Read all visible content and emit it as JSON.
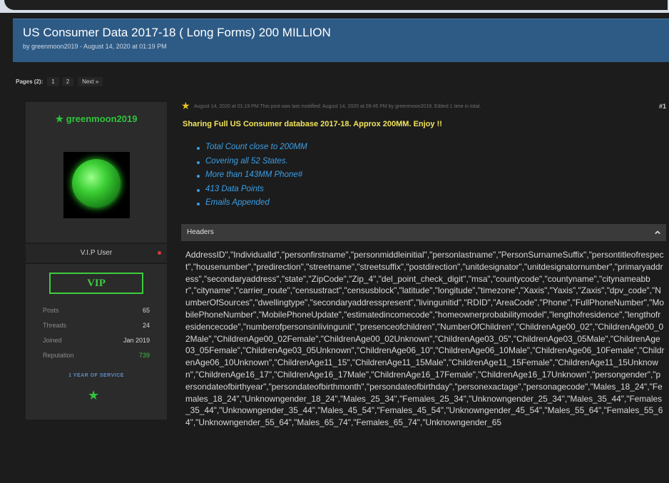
{
  "thread": {
    "title": "US Consumer Data 2017-18 ( Long Forms) 200 MILLION",
    "byline": "by greenmoon2019 - August 14, 2020 at 01:19 PM"
  },
  "pagination": {
    "label": "Pages (2):",
    "pages": [
      "1",
      "2"
    ],
    "next_label": "Next »"
  },
  "user": {
    "username": "★ greenmoon2019",
    "role": "V.I.P User",
    "badge": "VIP",
    "stats": [
      {
        "key": "Posts",
        "value": "65"
      },
      {
        "key": "Threads",
        "value": "24"
      },
      {
        "key": "Joined",
        "value": "Jan 2019"
      },
      {
        "key": "Reputation",
        "value": "739"
      }
    ],
    "service": "1 YEAR OF SERVICE"
  },
  "post": {
    "meta": "August 14, 2020 at 01:19 PM   This post was last modified: August 14, 2020 at 09:45 PM by greenmoon2019. Edited 1 time in total.",
    "number": "#1",
    "headline": "Sharing Full US Consumer database 2017-18. Approx 200MM. Enjoy !!",
    "bullets": [
      "Total Count close to 200MM",
      "Covering all 52 States.",
      "More than 143MM Phone#",
      "413 Data Points",
      "Emails Appended"
    ],
    "headers_label": "Headers",
    "headers_text": "AddressID\",\"IndividualId\",\"personfirstname\",\"personmiddleinitial\",\"personlastname\",\"PersonSurnameSuffix\",\"persontitleofrespect\",\"housenumber\",\"predirection\",\"streetname\",\"streetsuffix\",\"postdirection\",\"unitdesignator\",\"unitdesignatornumber\",\"primaryaddress\",\"secondaryaddress\",\"state\",\"ZipCode\",\"Zip_4\",\"del_point_check_digit\",\"msa\",\"countycode\",\"countyname\",\"citynameabbr\",\"cityname\",\"carrier_route\",\"censustract\",\"censusblock\",\"latitude\",\"longitude\",\"timezone\",\"Xaxis\",\"Yaxis\",\"Zaxis\",\"dpv_code\",\"NumberOfSources\",\"dwellingtype\",\"secondaryaddresspresent\",\"livingunitid\",\"RDID\",\"AreaCode\",\"Phone\",\"FullPhoneNumber\",\"MobilePhoneNumber\",\"MobilePhoneUpdate\",\"estimatedincomecode\",\"homeownerprobabilitymodel\",\"lengthofresidence\",\"lengthofresidencecode\",\"numberofpersonsinlivingunit\",\"presenceofchildren\",\"NumberOfChildren\",\"ChildrenAge00_02\",\"ChildrenAge00_02Male\",\"ChildrenAge00_02Female\",\"ChildrenAge00_02Unknown\",\"ChildrenAge03_05\",\"ChildrenAge03_05Male\",\"ChildrenAge03_05Female\",\"ChildrenAge03_05Unknown\",\"ChildrenAge06_10\",\"ChildrenAge06_10Male\",\"ChildrenAge06_10Female\",\"ChildrenAge06_10Unknown\",\"ChildrenAge11_15\",\"ChildrenAge11_15Male\",\"ChildrenAge11_15Female\",\"ChildrenAge11_15Unknown\",\"ChildrenAge16_17\",\"ChildrenAge16_17Male\",\"ChildrenAge16_17Female\",\"ChildrenAge16_17Unknown\",\"persongender\",\"persondateofbirthyear\",\"persondateofbirthmonth\",\"persondateofbirthday\",\"personexactage\",\"personagecode\",\"Males_18_24\",\"Females_18_24\",\"Unknowngender_18_24\",\"Males_25_34\",\"Females_25_34\",\"Unknowngender_25_34\",\"Males_35_44\",\"Females_35_44\",\"Unknowngender_35_44\",\"Males_45_54\",\"Females_45_54\",\"Unknowngender_45_54\",\"Males_55_64\",\"Females_55_64\",\"Unknowngender_55_64\",\"Males_65_74\",\"Females_65_74\",\"Unknowngender_65"
  },
  "colors": {
    "header_bg": "#2e5b86",
    "username": "#2fc43c",
    "headline": "#f2e35c",
    "bullet": "#3b9fe7",
    "reputation": "#39c13c"
  },
  "icons": {
    "post_star": "star-icon",
    "service_star": "star-icon",
    "collapse": "chevron-up-icon"
  }
}
